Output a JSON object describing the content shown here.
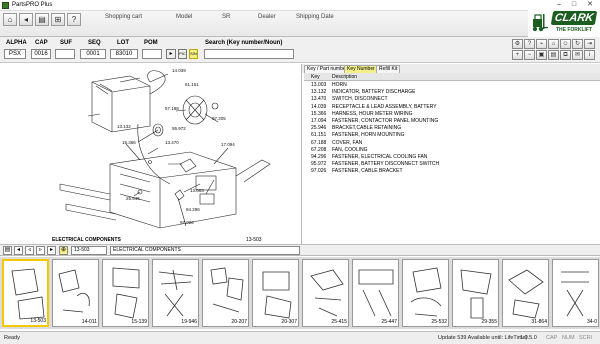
{
  "window": {
    "title": "PartsPRO Plus"
  },
  "topbar": {
    "links": [
      "Shopping cart",
      "Model",
      "SR",
      "Dealer",
      "Shipping Date"
    ]
  },
  "logo": {
    "brand": "CLARK",
    "tagline": "THE FORKLIFT"
  },
  "fields": {
    "alpha": {
      "label": "ALPHA",
      "value": "PSX"
    },
    "cap": {
      "label": "CAP",
      "value": "0016"
    },
    "suf": {
      "label": "SUF",
      "value": ""
    },
    "seq": {
      "label": "SEQ",
      "value": "0001"
    },
    "lot": {
      "label": "LOT",
      "value": "83010"
    },
    "pom": {
      "label": "POM",
      "value": ""
    },
    "search_label": "Search (Key number/Noun)",
    "search_value": "",
    "pic_btn": "PIC",
    "sn_btn": "S/N"
  },
  "drawing": {
    "caption": "ELECTRICAL COMPONENTS",
    "number": "13-503",
    "callouts": [
      "14.039",
      "61.151",
      "57.188",
      "97.205",
      "13.132",
      "95.972",
      "15.366",
      "13.470",
      "17.094",
      "13.003",
      "25.946",
      "94.296",
      "97.026"
    ]
  },
  "parts_tabs": [
    "Key / Part number",
    "Key Number",
    "Refill Kit"
  ],
  "parts": {
    "headers": [
      "Key",
      "Description"
    ],
    "rows": [
      {
        "key": "13.003",
        "desc": "HORN"
      },
      {
        "key": "13.132",
        "desc": "INDICATOR, BATTERY DISCHARGE"
      },
      {
        "key": "13.470",
        "desc": "SWITCH, DISCONNECT"
      },
      {
        "key": "14.039",
        "desc": "RECEPTACLE & LEAD ASSEMBLY, BATTERY"
      },
      {
        "key": "15.366",
        "desc": "HARNESS, HOUR METER WIRING"
      },
      {
        "key": "17.094",
        "desc": "FASTENER, CONTACTOR PANEL MOUNTING"
      },
      {
        "key": "25.946",
        "desc": "BRACKET,CABLE RETAINING"
      },
      {
        "key": "61.151",
        "desc": "FASTENER, HORN MOUNTING"
      },
      {
        "key": "67.188",
        "desc": "COVER, FAN"
      },
      {
        "key": "67.208",
        "desc": "FAN, COOLING"
      },
      {
        "key": "94.296",
        "desc": "FASTENER, ELECTRICAL COOLING FAN"
      },
      {
        "key": "95.972",
        "desc": "FASTENER, BATTERY DISCONNECT SWITCH"
      },
      {
        "key": "97.026",
        "desc": "FASTENER, CABLE BRACKET"
      }
    ]
  },
  "nav": {
    "page": "13-503",
    "section": "ELECTRICAL COMPONENTS"
  },
  "thumbnails": [
    "13-503",
    "14-011",
    "15-139",
    "19-946",
    "20-207",
    "20-307",
    "25-415",
    "25-447",
    "25-532",
    "29-355",
    "31-864",
    "34-0"
  ],
  "status": {
    "left": "Ready",
    "update": "Update 539  Available until: LifeTime)",
    "version": "1.0.5.0",
    "cap": "CAP",
    "num": "NUM",
    "scrl": "SCRl"
  },
  "colors": {
    "highlight": "#f3f08a",
    "brand_green": "#1b5e20"
  }
}
